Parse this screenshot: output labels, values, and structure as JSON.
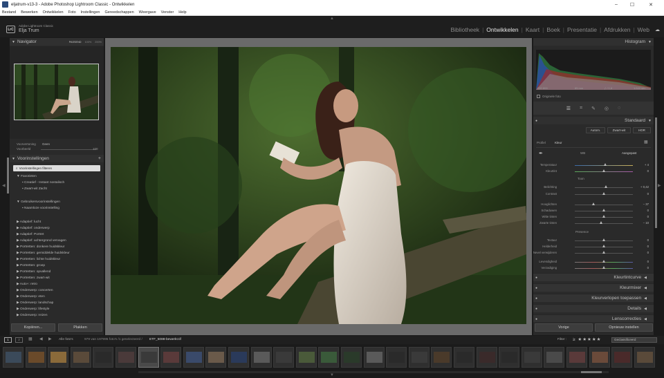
{
  "window": {
    "title": "eljatrum-v13-3 - Adobe Photoshop Lightroom Classic - Ontwikkelen",
    "minimize": "–",
    "maximize": "☐",
    "close": "✕"
  },
  "menu": [
    "Bestand",
    "Bewerken",
    "Ontwikkelen",
    "Foto",
    "Instellingen",
    "Gereedschappen",
    "Weergave",
    "Venster",
    "Help"
  ],
  "identity": {
    "logo": "LrC",
    "product": "Adobe Lightroom Classic",
    "user": "Elja Trum"
  },
  "modules": [
    "Bibliotheek",
    "Ontwikkelen",
    "Kaart",
    "Boek",
    "Presentatie",
    "Afdrukken",
    "Web"
  ],
  "active_module": "Ontwikkelen",
  "navigator": {
    "title": "Navigator",
    "zoom_opts": [
      "PASSEND",
      "100%",
      "200%"
    ]
  },
  "softproof": {
    "label1": "Voorvertoning",
    "val1": "Geen",
    "label2": "Voorbeeld",
    "val2": "100"
  },
  "presets": {
    "title": "Voorinstellingen",
    "filter": "Voorinstellingen filteren",
    "favorites_head": "Favorieten",
    "favorites": [
      "Creatief - Instant nostalisch",
      "Zwart-wit Zacht"
    ],
    "user_head": "Gebruikersvoorinstellingen",
    "user": [
      "Naamloze voorinstelling"
    ],
    "groups": [
      "Adaptief: lucht",
      "Adaptief: onderwerp",
      "Adaptief: Portret",
      "Adaptief: achtergrond vervagen",
      "Portretten: donkere huidskleur",
      "Portretten: gemiddelde huidskleur",
      "Portretten: lichte huidskleur",
      "Portretten: groep",
      "Portretten: opvallend",
      "Portretten: zwart-wit",
      "Auto+: retro",
      "Onderwerp: concerten",
      "Onderwerp: eten",
      "Onderwerp: landschap",
      "Onderwerp: lifestyle",
      "Onderwerp: reizen"
    ]
  },
  "left_buttons": {
    "copy": "Kopiëren...",
    "paste": "Plakken"
  },
  "histogram": {
    "title": "Histogram",
    "iso": "ISO 800",
    "focal": "85 mm",
    "aperture": "ƒ / 1,8",
    "shutter": "1/160 sec",
    "original": "Originele foto"
  },
  "basic": {
    "title": "Standaard",
    "modes": [
      "Autom.",
      "Zwart-wit",
      "HDR"
    ],
    "profile_label": "Profiel",
    "profile_value": "Kleur",
    "wb_label": "WB",
    "wb_value": "Aangepast",
    "tone_head": "Toon",
    "presence_head": "Presence",
    "sliders": [
      {
        "label": "Temperatuur",
        "value": "+ 4",
        "pos": 0.52,
        "group": "wb"
      },
      {
        "label": "Kleurtint",
        "value": "0",
        "pos": 0.5,
        "group": "wb"
      },
      {
        "label": "Belichting",
        "value": "+ 0,42",
        "pos": 0.54,
        "group": "tone"
      },
      {
        "label": "Contrast",
        "value": "0",
        "pos": 0.5,
        "group": "tone"
      },
      {
        "label": "Hooglichten",
        "value": "− 37",
        "pos": 0.32,
        "group": "tone2"
      },
      {
        "label": "Schaduwen",
        "value": "0",
        "pos": 0.5,
        "group": "tone2"
      },
      {
        "label": "Witte tinten",
        "value": "0",
        "pos": 0.5,
        "group": "tone2"
      },
      {
        "label": "Zwarte tinten",
        "value": "− 10",
        "pos": 0.45,
        "group": "tone2"
      },
      {
        "label": "Textuur",
        "value": "0",
        "pos": 0.5,
        "group": "pres"
      },
      {
        "label": "Helderheid",
        "value": "0",
        "pos": 0.5,
        "group": "pres"
      },
      {
        "label": "Nevel verwijderen",
        "value": "0",
        "pos": 0.5,
        "group": "pres"
      },
      {
        "label": "Levendigheid",
        "value": "0",
        "pos": 0.5,
        "group": "pres2"
      },
      {
        "label": "Verzadiging",
        "value": "0",
        "pos": 0.5,
        "group": "pres2"
      }
    ]
  },
  "sections": [
    "Kleurtintcurve",
    "Kleurmixer",
    "Kleurverlopen toepassen",
    "Details",
    "Lenscorrecties"
  ],
  "right_buttons": {
    "prev": "Vorige",
    "reset": "Opnieuw instellen"
  },
  "filmbar": {
    "source": "Alle foto's",
    "count": "979 van 197995 foto's /1 geselecteerd /",
    "file": "ETF_5088-bewerkt.tif",
    "filter_label": "Filter :",
    "filter_value": "Geclassificeerd"
  },
  "colors": {
    "accent": "#e6e6e6",
    "panel": "#2a2a2a",
    "bg": "#1a1a1a"
  }
}
